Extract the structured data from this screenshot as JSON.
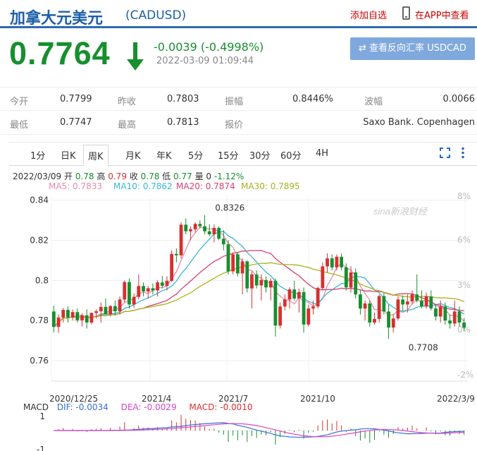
{
  "header": {
    "title": "加拿大元美元",
    "code": "(CADUSD)",
    "add_favorite": "添加自选",
    "app_view": "在APP中查看"
  },
  "quote": {
    "price": "0.7764",
    "change": "-0.0039 (-0.4998%)",
    "time": "2022-03-09 01:09:44",
    "reverse_button": "⇄ 查看反向汇率 USDCAD",
    "direction": "down",
    "color_down": "#178f2f",
    "color_up": "#d63030"
  },
  "stats": {
    "open_label": "今开",
    "open": "0.7799",
    "prev_close_label": "昨收",
    "prev_close": "0.7803",
    "amplitude_label": "振幅",
    "amplitude": "0.8446%",
    "spread_label": "波幅",
    "spread": "0.0066",
    "low_label": "最低",
    "low": "0.7747",
    "high_label": "最高",
    "high": "0.7813",
    "quoter_label": "报价",
    "quoter": "Saxo Bank. Copenhagen"
  },
  "tabs": [
    "1分",
    "日K",
    "周K",
    "月K",
    "年K",
    "5分",
    "15分",
    "30分",
    "60分",
    "4H"
  ],
  "active_tab": "周K",
  "bar_info": {
    "date": "2022/03/09",
    "open_label": "开",
    "open": "0.78",
    "high_label": "高",
    "high": "0.79",
    "close_label": "收",
    "close": "0.78",
    "low_label": "低",
    "low": "0.77",
    "volume_label": "量",
    "volume": "0",
    "pct": "-1.12%"
  },
  "ma_legend": [
    {
      "text": "MA5: 0.7833",
      "color": "#e88aa6"
    },
    {
      "text": "MA10: 0.7862",
      "color": "#3ab6d8"
    },
    {
      "text": "MA20: 0.7874",
      "color": "#d8406a"
    },
    {
      "text": "MA30: 0.7895",
      "color": "#a8b21c"
    }
  ],
  "macd_legend": {
    "label": "MACD",
    "dif": "DIF: -0.0034",
    "dif_color": "#3a6fcf",
    "dea": "DEA: -0.0029",
    "dea_color": "#d846c8",
    "macd": "MACD: -0.0010",
    "macd_color": "#d63030"
  },
  "watermark": "sina新浪财经",
  "chart_data": {
    "type": "candlestick",
    "y_ticks": [
      "0.84",
      "0.82",
      "0.8",
      "0.78",
      "0.76"
    ],
    "ylim": [
      0.754,
      0.842
    ],
    "pct_ticks": [
      "8%",
      "6%",
      "3%",
      "0%",
      "-2%"
    ],
    "x_ticks": [
      "2020/12/25",
      "2021/4",
      "2021/7",
      "2021/10",
      "2022/3/9"
    ],
    "annotations": [
      {
        "text": "0.8326",
        "value": 0.8326,
        "bar": 36
      },
      {
        "text": "0.7708",
        "value": 0.7708,
        "bar": 77
      }
    ],
    "candles": [
      [
        0.7845,
        0.7874,
        0.774,
        0.7768
      ],
      [
        0.7768,
        0.783,
        0.7738,
        0.7815
      ],
      [
        0.7815,
        0.7862,
        0.779,
        0.7853
      ],
      [
        0.7853,
        0.787,
        0.779,
        0.7815
      ],
      [
        0.7815,
        0.7855,
        0.78,
        0.7842
      ],
      [
        0.7842,
        0.786,
        0.779,
        0.7801
      ],
      [
        0.7801,
        0.7835,
        0.777,
        0.7826
      ],
      [
        0.7826,
        0.7856,
        0.776,
        0.779
      ],
      [
        0.779,
        0.784,
        0.778,
        0.7838
      ],
      [
        0.7838,
        0.7856,
        0.781,
        0.7846
      ],
      [
        0.7846,
        0.789,
        0.779,
        0.7868
      ],
      [
        0.7868,
        0.791,
        0.784,
        0.7832
      ],
      [
        0.7832,
        0.7877,
        0.782,
        0.7872
      ],
      [
        0.7872,
        0.79,
        0.7825,
        0.7846
      ],
      [
        0.7846,
        0.792,
        0.783,
        0.7905
      ],
      [
        0.7905,
        0.8,
        0.7892,
        0.7992
      ],
      [
        0.7992,
        0.801,
        0.786,
        0.788
      ],
      [
        0.788,
        0.7935,
        0.7862,
        0.7918
      ],
      [
        0.7918,
        0.803,
        0.7905,
        0.7972
      ],
      [
        0.7972,
        0.799,
        0.792,
        0.7945
      ],
      [
        0.7945,
        0.7972,
        0.791,
        0.7961
      ],
      [
        0.7961,
        0.7985,
        0.793,
        0.795
      ],
      [
        0.795,
        0.8,
        0.792,
        0.799
      ],
      [
        0.799,
        0.8022,
        0.796,
        0.7973
      ],
      [
        0.7973,
        0.802,
        0.795,
        0.7998
      ],
      [
        0.7998,
        0.815,
        0.7992,
        0.8132
      ],
      [
        0.8132,
        0.816,
        0.809,
        0.8125
      ],
      [
        0.8125,
        0.829,
        0.811,
        0.8278
      ],
      [
        0.8278,
        0.831,
        0.823,
        0.8245
      ],
      [
        0.8245,
        0.827,
        0.82,
        0.8255
      ],
      [
        0.8255,
        0.829,
        0.824,
        0.8282
      ],
      [
        0.8282,
        0.83,
        0.826,
        0.827
      ],
      [
        0.827,
        0.8326,
        0.823,
        0.8245
      ],
      [
        0.8245,
        0.828,
        0.822,
        0.823
      ],
      [
        0.823,
        0.828,
        0.819,
        0.8262
      ],
      [
        0.8262,
        0.827,
        0.82,
        0.8208
      ],
      [
        0.8208,
        0.825,
        0.815,
        0.818
      ],
      [
        0.818,
        0.82,
        0.803,
        0.8045
      ],
      [
        0.8045,
        0.814,
        0.803,
        0.813
      ],
      [
        0.813,
        0.814,
        0.802,
        0.8035
      ],
      [
        0.8035,
        0.811,
        0.793,
        0.8095
      ],
      [
        0.8095,
        0.81,
        0.794,
        0.796
      ],
      [
        0.796,
        0.8045,
        0.786,
        0.803
      ],
      [
        0.803,
        0.805,
        0.796,
        0.7975
      ],
      [
        0.7975,
        0.803,
        0.79,
        0.8002
      ],
      [
        0.8002,
        0.802,
        0.794,
        0.7965
      ],
      [
        0.7965,
        0.801,
        0.79,
        0.7998
      ],
      [
        0.7998,
        0.801,
        0.772,
        0.7775
      ],
      [
        0.7775,
        0.789,
        0.776,
        0.787
      ],
      [
        0.787,
        0.793,
        0.785,
        0.7905
      ],
      [
        0.7905,
        0.7965,
        0.786,
        0.7955
      ],
      [
        0.7955,
        0.7998,
        0.79,
        0.791
      ],
      [
        0.791,
        0.796,
        0.784,
        0.7942
      ],
      [
        0.7942,
        0.7965,
        0.774,
        0.778
      ],
      [
        0.778,
        0.788,
        0.777,
        0.786
      ],
      [
        0.786,
        0.79,
        0.783,
        0.787
      ],
      [
        0.787,
        0.797,
        0.786,
        0.7962
      ],
      [
        0.7962,
        0.809,
        0.795,
        0.807
      ],
      [
        0.807,
        0.8135,
        0.804,
        0.811
      ],
      [
        0.811,
        0.813,
        0.805,
        0.8065
      ],
      [
        0.8065,
        0.813,
        0.805,
        0.8118
      ],
      [
        0.8118,
        0.8135,
        0.805,
        0.8065
      ],
      [
        0.8065,
        0.8085,
        0.795,
        0.7965
      ],
      [
        0.7965,
        0.807,
        0.794,
        0.804
      ],
      [
        0.804,
        0.806,
        0.791,
        0.793
      ],
      [
        0.793,
        0.795,
        0.783,
        0.786
      ],
      [
        0.786,
        0.79,
        0.78,
        0.7885
      ],
      [
        0.7885,
        0.79,
        0.777,
        0.779
      ],
      [
        0.779,
        0.784,
        0.778,
        0.7808
      ],
      [
        0.7808,
        0.793,
        0.779,
        0.7922
      ],
      [
        0.7922,
        0.794,
        0.783,
        0.7845
      ],
      [
        0.7845,
        0.788,
        0.7708,
        0.7765
      ],
      [
        0.7765,
        0.783,
        0.774,
        0.781
      ],
      [
        0.781,
        0.792,
        0.78,
        0.7905
      ],
      [
        0.7905,
        0.7925,
        0.785,
        0.788
      ],
      [
        0.788,
        0.793,
        0.784,
        0.7895
      ],
      [
        0.7895,
        0.795,
        0.788,
        0.793
      ],
      [
        0.793,
        0.803,
        0.789,
        0.79
      ],
      [
        0.79,
        0.795,
        0.786,
        0.787
      ],
      [
        0.787,
        0.794,
        0.786,
        0.792
      ],
      [
        0.792,
        0.795,
        0.785,
        0.786
      ],
      [
        0.786,
        0.788,
        0.78,
        0.782
      ],
      [
        0.782,
        0.79,
        0.779,
        0.787
      ],
      [
        0.787,
        0.789,
        0.778,
        0.78
      ],
      [
        0.78,
        0.783,
        0.776,
        0.7785
      ],
      [
        0.7785,
        0.79,
        0.777,
        0.7845
      ],
      [
        0.7845,
        0.787,
        0.777,
        0.779
      ],
      [
        0.779,
        0.7813,
        0.7747,
        0.7764
      ]
    ]
  }
}
